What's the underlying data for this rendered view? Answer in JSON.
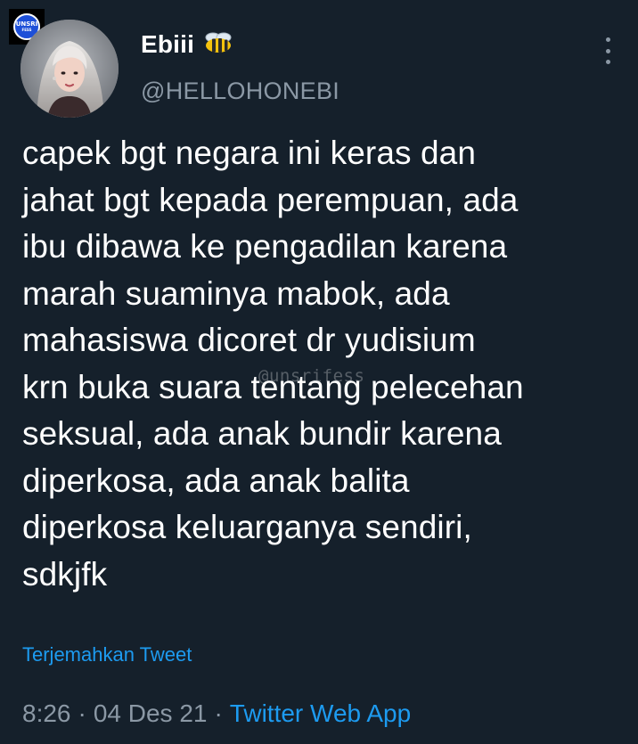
{
  "watermark": {
    "logo_text": "UNSRI",
    "logo_subtext": "FESS",
    "text": "@unsrifess"
  },
  "user": {
    "display_name": "Ebiii",
    "name_emoji_icon": "bee-icon",
    "handle": "@HELLOHONEBI"
  },
  "more_icon": "vertical-ellipsis-icon",
  "tweet": {
    "lines": [
      "capek bgt negara ini keras dan",
      "jahat bgt kepada perempuan, ada",
      "ibu dibawa ke pengadilan karena",
      "marah suaminya mabok, ada",
      "mahasiswa dicoret dr yudisium",
      "krn buka suara tentang pelecehan",
      "seksual, ada anak bundir karena",
      "diperkosa, ada anak balita",
      "diperkosa keluarganya sendiri,",
      "sdkjfk"
    ],
    "translate_label": "Terjemahkan Tweet",
    "time": "8:26",
    "separator": "·",
    "date": "04 Des 21",
    "source": "Twitter Web App"
  },
  "colors": {
    "background": "#15202b",
    "text_primary": "#ffffff",
    "text_secondary": "#8b98a5",
    "accent": "#1d9bf0"
  }
}
